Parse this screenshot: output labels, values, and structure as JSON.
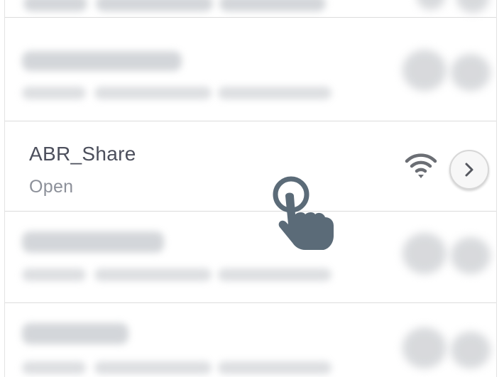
{
  "network_list": {
    "selected": {
      "name": "ABR_Share",
      "security": "Open"
    }
  },
  "colors": {
    "title_text": "#4c4f5c",
    "subtitle_text": "#8c9099",
    "icon_gray": "#6b6e74",
    "hand": "#5b6b78",
    "divider": "#dcdcdc"
  },
  "icons": {
    "wifi": "wifi-signal-icon",
    "info": "chevron-right-icon",
    "gesture": "tap-hand-icon"
  }
}
